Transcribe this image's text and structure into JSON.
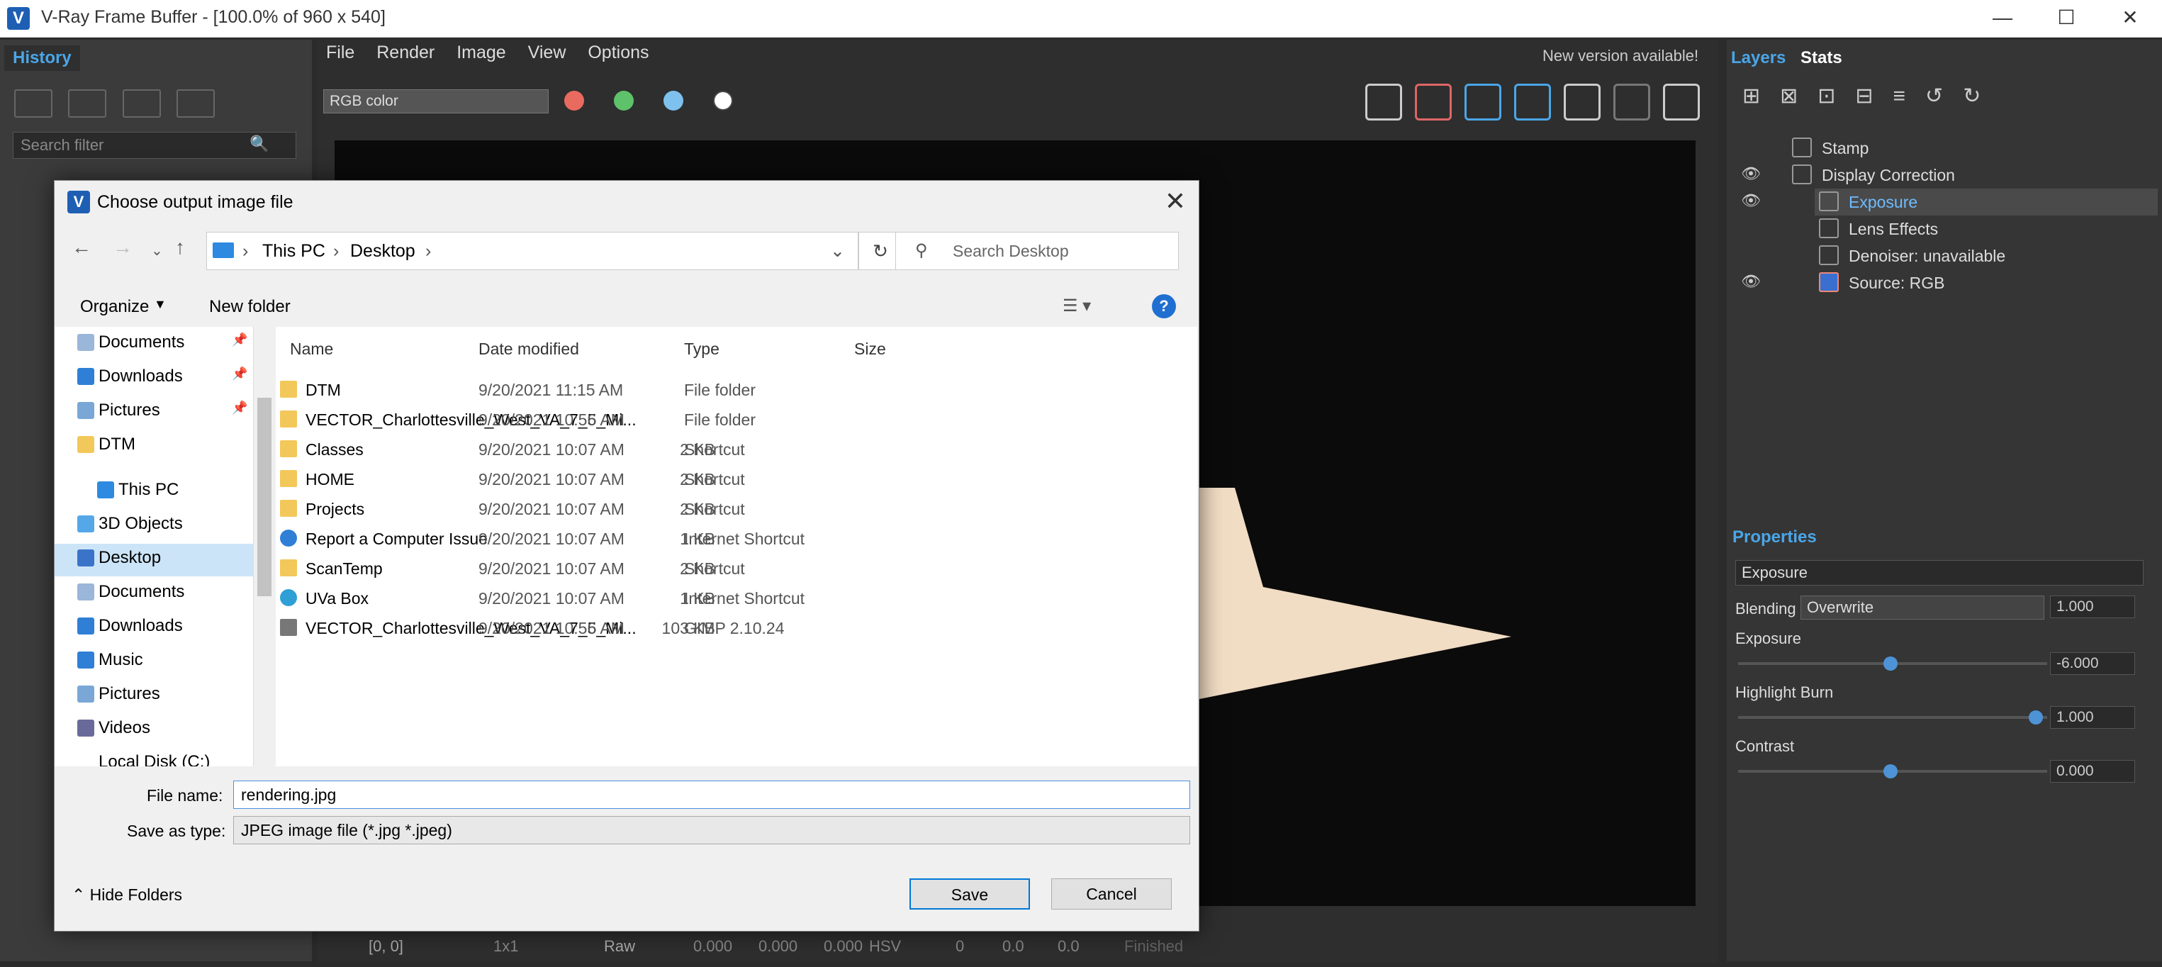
{
  "window": {
    "title": "V-Ray Frame Buffer - [100.0% of 960 x 540]",
    "app_icon": "V"
  },
  "history": {
    "tab": "History",
    "search_placeholder": "Search filter"
  },
  "menu": {
    "items": [
      "File",
      "Render",
      "Image",
      "View",
      "Options"
    ],
    "new_version": "New version available!"
  },
  "toolbar": {
    "channel": "RGB color",
    "colors": [
      "#e96a5f",
      "#5ec26a",
      "#7ec0ee",
      "#ffffff"
    ]
  },
  "statusbar": {
    "coords": "[0, 0]",
    "zoom": "1x1",
    "raw": "Raw",
    "r": "0.000",
    "g": "0.000",
    "b": "0.000",
    "mode": "HSV",
    "h": "0",
    "s": "0.0",
    "v": "0.0",
    "status": "Finished"
  },
  "right_panel": {
    "tabs": [
      "Layers",
      "Stats"
    ],
    "layers": [
      {
        "name": "Stamp",
        "eye": false,
        "indent": 0
      },
      {
        "name": "Display Correction",
        "eye": true,
        "indent": 0
      },
      {
        "name": "Exposure",
        "eye": true,
        "indent": 1,
        "selected": true
      },
      {
        "name": "Lens Effects",
        "eye": false,
        "indent": 1
      },
      {
        "name": "Denoiser: unavailable",
        "eye": false,
        "indent": 1
      },
      {
        "name": "Source: RGB",
        "eye": true,
        "indent": 0
      }
    ],
    "properties": {
      "header": "Properties",
      "layer_name": "Exposure",
      "blending_label": "Blending",
      "blending_value": "Overwrite",
      "blending_amount": "1.000",
      "exposure_label": "Exposure",
      "exposure_value": "-6.000",
      "highlight_label": "Highlight Burn",
      "highlight_value": "1.000",
      "contrast_label": "Contrast",
      "contrast_value": "0.000"
    }
  },
  "dialog": {
    "title": "Choose output image file",
    "breadcrumb": [
      "This PC",
      "Desktop"
    ],
    "search_placeholder": "Search Desktop",
    "organize": "Organize",
    "new_folder": "New folder",
    "nav_items": [
      {
        "label": "Documents",
        "pinned": true,
        "color": "#9ab6d8"
      },
      {
        "label": "Downloads",
        "pinned": true,
        "color": "#2f7fd6"
      },
      {
        "label": "Pictures",
        "pinned": true,
        "color": "#7aa7d6"
      },
      {
        "label": "DTM",
        "pinned": false,
        "color": "#f3c85a"
      },
      {
        "label": "This PC",
        "pinned": false,
        "color": "#2d8ae0"
      },
      {
        "label": "3D Objects",
        "pinned": false,
        "color": "#55a7e8"
      },
      {
        "label": "Desktop",
        "pinned": false,
        "color": "#3a74c9",
        "selected": true
      },
      {
        "label": "Documents",
        "pinned": false,
        "color": "#9ab6d8"
      },
      {
        "label": "Downloads",
        "pinned": false,
        "color": "#2f7fd6"
      },
      {
        "label": "Music",
        "pinned": false,
        "color": "#2f7fd6"
      },
      {
        "label": "Pictures",
        "pinned": false,
        "color": "#7aa7d6"
      },
      {
        "label": "Videos",
        "pinned": false,
        "color": "#6a6a9a"
      },
      {
        "label": "Local Disk (C:)",
        "pinned": false,
        "color": "#888888"
      }
    ],
    "columns": [
      "Name",
      "Date modified",
      "Type",
      "Size"
    ],
    "files": [
      {
        "name": "DTM",
        "date": "9/20/2021 11:15 AM",
        "type": "File folder",
        "size": "",
        "icon": "#f3c85a"
      },
      {
        "name": "VECTOR_Charlottesville_West_VA_7_5_Mi...",
        "date": "9/20/2021 10:56 AM",
        "type": "File folder",
        "size": "",
        "icon": "#f3c85a"
      },
      {
        "name": "Classes",
        "date": "9/20/2021 10:07 AM",
        "type": "Shortcut",
        "size": "2 KB",
        "icon": "#f3c85a"
      },
      {
        "name": "HOME",
        "date": "9/20/2021 10:07 AM",
        "type": "Shortcut",
        "size": "2 KB",
        "icon": "#f3c85a"
      },
      {
        "name": "Projects",
        "date": "9/20/2021 10:07 AM",
        "type": "Shortcut",
        "size": "2 KB",
        "icon": "#f3c85a"
      },
      {
        "name": "Report a Computer Issue",
        "date": "9/20/2021 10:07 AM",
        "type": "Internet Shortcut",
        "size": "1 KB",
        "icon": "#2f7fd6"
      },
      {
        "name": "ScanTemp",
        "date": "9/20/2021 10:07 AM",
        "type": "Shortcut",
        "size": "2 KB",
        "icon": "#f3c85a"
      },
      {
        "name": "UVa Box",
        "date": "9/20/2021 10:07 AM",
        "type": "Internet Shortcut",
        "size": "1 KB",
        "icon": "#2f9fd6"
      },
      {
        "name": "VECTOR_Charlottesville_West_VA_7_5_Mi...",
        "date": "9/20/2021 10:56 AM",
        "type": "GIMP 2.10.24",
        "size": "103 KB",
        "icon": "#777777"
      }
    ],
    "file_name_label": "File name:",
    "file_name_value": "rendering.jpg",
    "save_type_label": "Save as type:",
    "save_type_value": "JPEG image file (*.jpg *.jpeg)",
    "hide_folders": "Hide Folders",
    "save": "Save",
    "cancel": "Cancel"
  }
}
